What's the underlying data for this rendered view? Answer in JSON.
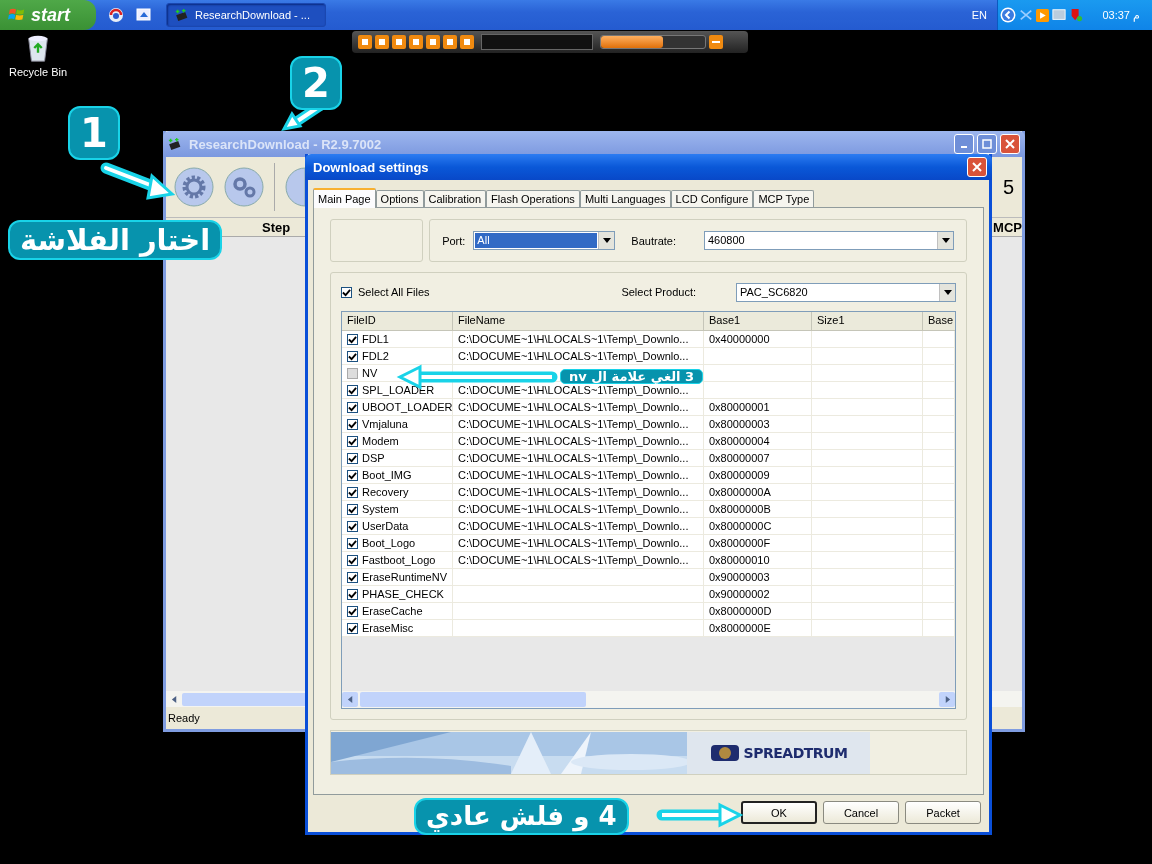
{
  "taskbar": {
    "start": "start",
    "tasks": [
      {
        "label": "ResearchDownload - ...",
        "selected": true
      }
    ],
    "language": "EN",
    "clock": "03:37 م"
  },
  "desktop_icons": [
    {
      "label": "Recycle Bin"
    }
  ],
  "main_window": {
    "title": "ResearchDownload - R2.9.7002",
    "columns": [
      "Step",
      "MCP"
    ],
    "counter": "5",
    "status": "Ready"
  },
  "dialog": {
    "title": "Download settings",
    "tabs": [
      {
        "label": "Main Page",
        "selected": true
      },
      {
        "label": "Options",
        "selected": false
      },
      {
        "label": "Calibration",
        "selected": false
      },
      {
        "label": "Flash Operations",
        "selected": false
      },
      {
        "label": "Multi Languages",
        "selected": false
      },
      {
        "label": "LCD Configure",
        "selected": false
      },
      {
        "label": "MCP Type",
        "selected": false
      }
    ],
    "port": {
      "label": "Port:",
      "value": "All",
      "highlighted": true
    },
    "baudrate": {
      "label": "Bautrate:",
      "value": "460800"
    },
    "select_all": {
      "label": "Select All Files",
      "checked": true
    },
    "product": {
      "label": "Select Product:",
      "value": "PAC_SC6820"
    },
    "table": {
      "columns": [
        "FileID",
        "FileName",
        "Base1",
        "Size1",
        "Base"
      ],
      "rows": [
        {
          "checked": true,
          "file_id": "FDL1",
          "file_name": "C:\\DOCUME~1\\H\\LOCALS~1\\Temp\\_Downlo...",
          "base1": "0x40000000"
        },
        {
          "checked": true,
          "file_id": "FDL2",
          "file_name": "C:\\DOCUME~1\\H\\LOCALS~1\\Temp\\_Downlo..."
        },
        {
          "checked": false,
          "file_id": "NV"
        },
        {
          "checked": true,
          "file_id": "SPL_LOADER",
          "file_name": "C:\\DOCUME~1\\H\\LOCALS~1\\Temp\\_Downlo..."
        },
        {
          "checked": true,
          "file_id": "UBOOT_LOADER",
          "file_name": "C:\\DOCUME~1\\H\\LOCALS~1\\Temp\\_Downlo...",
          "base1": "0x80000001"
        },
        {
          "checked": true,
          "file_id": "Vmjaluna",
          "file_name": "C:\\DOCUME~1\\H\\LOCALS~1\\Temp\\_Downlo...",
          "base1": "0x80000003"
        },
        {
          "checked": true,
          "file_id": "Modem",
          "file_name": "C:\\DOCUME~1\\H\\LOCALS~1\\Temp\\_Downlo...",
          "base1": "0x80000004"
        },
        {
          "checked": true,
          "file_id": "DSP",
          "file_name": "C:\\DOCUME~1\\H\\LOCALS~1\\Temp\\_Downlo...",
          "base1": "0x80000007"
        },
        {
          "checked": true,
          "file_id": "Boot_IMG",
          "file_name": "C:\\DOCUME~1\\H\\LOCALS~1\\Temp\\_Downlo...",
          "base1": "0x80000009"
        },
        {
          "checked": true,
          "file_id": "Recovery",
          "file_name": "C:\\DOCUME~1\\H\\LOCALS~1\\Temp\\_Downlo...",
          "base1": "0x8000000A"
        },
        {
          "checked": true,
          "file_id": "System",
          "file_name": "C:\\DOCUME~1\\H\\LOCALS~1\\Temp\\_Downlo...",
          "base1": "0x8000000B"
        },
        {
          "checked": true,
          "file_id": "UserData",
          "file_name": "C:\\DOCUME~1\\H\\LOCALS~1\\Temp\\_Downlo...",
          "base1": "0x8000000C"
        },
        {
          "checked": true,
          "file_id": "Boot_Logo",
          "file_name": "C:\\DOCUME~1\\H\\LOCALS~1\\Temp\\_Downlo...",
          "base1": "0x8000000F"
        },
        {
          "checked": true,
          "file_id": "Fastboot_Logo",
          "file_name": "C:\\DOCUME~1\\H\\LOCALS~1\\Temp\\_Downlo...",
          "base1": "0x80000010"
        },
        {
          "checked": true,
          "file_id": "EraseRuntimeNV",
          "base1": "0x90000003"
        },
        {
          "checked": true,
          "file_id": "PHASE_CHECK",
          "base1": "0x90000002"
        },
        {
          "checked": true,
          "file_id": "EraseCache",
          "base1": "0x8000000D"
        },
        {
          "checked": true,
          "file_id": "EraseMisc",
          "base1": "0x8000000E"
        }
      ]
    },
    "banner": {
      "brand": "SPREADTRUM"
    },
    "buttons": [
      {
        "label": "OK",
        "selected": true
      },
      {
        "label": "Cancel",
        "selected": false
      },
      {
        "label": "Packet",
        "selected": false
      }
    ]
  },
  "annotations": [
    {
      "text": "1"
    },
    {
      "text": "2"
    },
    {
      "text": "اختار الفلاشة"
    },
    {
      "text": "3 الغي علامة ال nv"
    },
    {
      "text": "4 و فلش عادي"
    }
  ]
}
